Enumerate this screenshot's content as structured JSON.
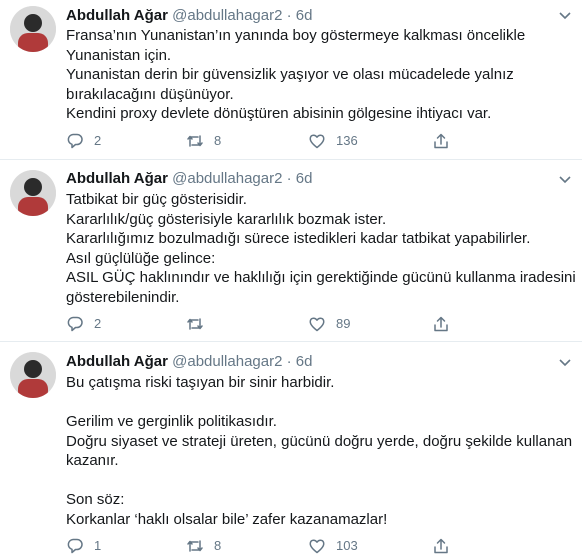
{
  "tweets": [
    {
      "name": "Abdullah Ağar",
      "handle": "@abdullahagar2",
      "sep": "·",
      "time": "6d",
      "lines": [
        "Fransa’nın Yunanistan’ın yanında boy göstermeye kalkması öncelikle",
        "Yunanistan için.",
        "Yunanistan derin bir güvensizlik yaşıyor ve olası mücadelede yalnız",
        "bırakılacağını düşünüyor.",
        "Kendini proxy devlete dönüştüren abisinin gölgesine ihtiyacı var."
      ],
      "replies": "2",
      "retweets": "8",
      "likes": "136"
    },
    {
      "name": "Abdullah Ağar",
      "handle": "@abdullahagar2",
      "sep": "·",
      "time": "6d",
      "lines": [
        "Tatbikat bir güç gösterisidir.",
        "Kararlılık/güç gösterisiyle kararlılık bozmak ister.",
        "Kararlılığımız bozulmadığı sürece istedikleri kadar tatbikat yapabilirler.",
        "Asıl güçlülüğe gelince:",
        "ASIL GÜÇ haklınındır ve haklılığı için gerektiğinde gücünü kullanma iradesini",
        "gösterebilenindir."
      ],
      "replies": "2",
      "retweets": "",
      "likes": "89"
    },
    {
      "name": "Abdullah Ağar",
      "handle": "@abdullahagar2",
      "sep": "·",
      "time": "6d",
      "lines": [
        "Bu çatışma riski taşıyan bir sinir harbidir.",
        "",
        "Gerilim ve gerginlik politikasıdır.",
        "Doğru siyaset ve strateji üreten, gücünü doğru yerde, doğru şekilde kullanan",
        "kazanır.",
        "",
        "Son söz:",
        "Korkanlar ‘haklı olsalar bile’ zafer kazanamazlar!"
      ],
      "replies": "1",
      "retweets": "8",
      "likes": "103"
    }
  ],
  "icons": {
    "caret": "chevron-down-icon",
    "reply": "reply-icon",
    "retweet": "retweet-icon",
    "like": "like-icon",
    "share": "share-icon"
  },
  "colors": {
    "text": "#14171a",
    "muted": "#657786",
    "divider": "#e6ecf0"
  }
}
